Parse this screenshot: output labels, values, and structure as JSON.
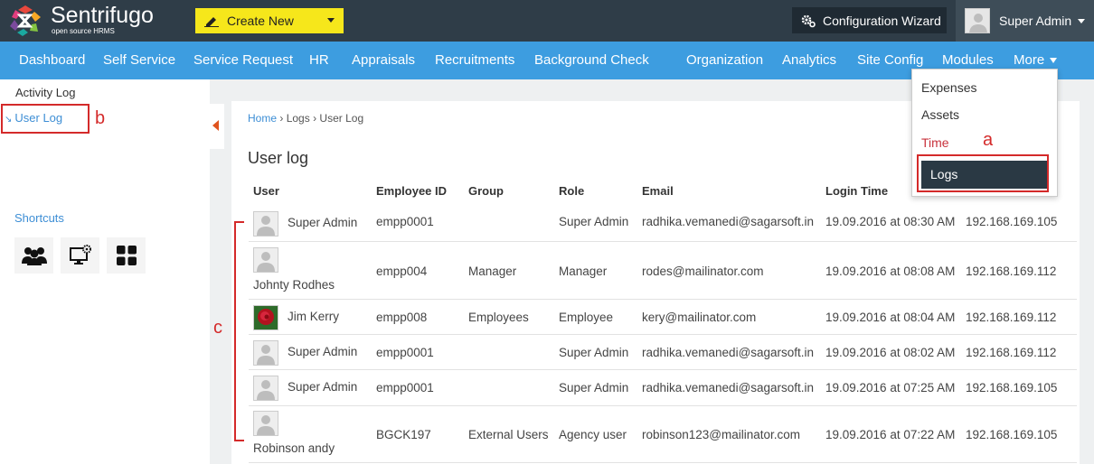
{
  "header": {
    "brand": "Sentrifugo",
    "brand_sub": "open source HRMS",
    "create_new": "Create New",
    "config_wizard": "Configuration Wizard",
    "user_name": "Super Admin"
  },
  "nav": {
    "dashboard": "Dashboard",
    "self_service": "Self Service",
    "service_request": "Service Request",
    "hr": "HR",
    "appraisals": "Appraisals",
    "recruitments": "Recruitments",
    "background_check": "Background Check",
    "organization": "Organization",
    "analytics": "Analytics",
    "site_config": "Site Config",
    "modules": "Modules",
    "more": "More"
  },
  "sidebar": {
    "activity_log": "Activity Log",
    "user_log": "User Log",
    "shortcuts": "Shortcuts",
    "annotation_b": "b"
  },
  "main": {
    "breadcrumb": {
      "home": "Home",
      "sep1": "›",
      "logs": "Logs",
      "sep2": "›",
      "current": "User Log"
    },
    "title": "User log",
    "columns": {
      "user": "User",
      "employee_id": "Employee ID",
      "group": "Group",
      "role": "Role",
      "email": "Email",
      "login_time": "Login Time"
    },
    "rows": [
      {
        "user": "Super Admin",
        "employee_id": "empp0001",
        "group": "",
        "role": "Super Admin",
        "email": "radhika.vemanedi@sagarsoft.in",
        "login_time": "19.09.2016 at 08:30 AM",
        "ip": "192.168.169.105"
      },
      {
        "user": "Johnty Rodhes",
        "employee_id": "empp004",
        "group": "Manager",
        "role": "Manager",
        "email": "rodes@mailinator.com",
        "login_time": "19.09.2016 at 08:08 AM",
        "ip": "192.168.169.112"
      },
      {
        "user": "Jim Kerry",
        "employee_id": "empp008",
        "group": "Employees",
        "role": "Employee",
        "email": "kery@mailinator.com",
        "login_time": "19.09.2016 at 08:04 AM",
        "ip": "192.168.169.112"
      },
      {
        "user": "Super Admin",
        "employee_id": "empp0001",
        "group": "",
        "role": "Super Admin",
        "email": "radhika.vemanedi@sagarsoft.in",
        "login_time": "19.09.2016 at 08:02 AM",
        "ip": "192.168.169.112"
      },
      {
        "user": "Super Admin",
        "employee_id": "empp0001",
        "group": "",
        "role": "Super Admin",
        "email": "radhika.vemanedi@sagarsoft.in",
        "login_time": "19.09.2016 at 07:25 AM",
        "ip": "192.168.169.105"
      },
      {
        "user": "Robinson andy",
        "employee_id": "BGCK197",
        "group": "External Users",
        "role": "Agency user",
        "email": "robinson123@mailinator.com",
        "login_time": "19.09.2016 at 07:22 AM",
        "ip": "192.168.169.105"
      }
    ],
    "annotation_c": "c"
  },
  "dropdown": {
    "items": [
      "Expenses",
      "Assets",
      "Time",
      "Logs"
    ],
    "annotation_a": "a"
  },
  "colors": {
    "topbar": "#2f3d48",
    "navbar": "#3d9de0",
    "create_button": "#f6e71b",
    "annotation": "#d42a2a",
    "link": "#3d8ed5"
  }
}
